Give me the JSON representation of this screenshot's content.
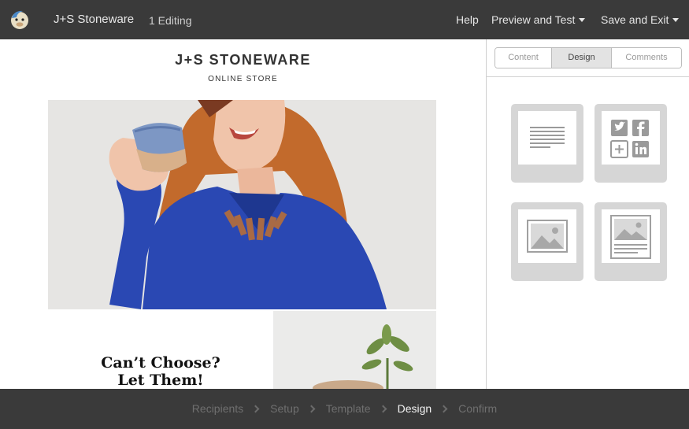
{
  "topbar": {
    "logo_icon": "mailchimp-freddie-icon",
    "app_title": "J+S Stoneware",
    "editing_status": "1 Editing",
    "help_label": "Help",
    "preview_label": "Preview and Test",
    "save_label": "Save and Exit"
  },
  "email": {
    "brand_name": "J+S STONEWARE",
    "brand_subtitle": "ONLINE STORE",
    "headline_line1": "Can’t Choose?",
    "headline_line2": "Let Them!"
  },
  "panel": {
    "tabs": [
      {
        "label": "Content",
        "active": false
      },
      {
        "label": "Design",
        "active": true
      },
      {
        "label": "Comments",
        "active": false
      }
    ],
    "blocks": [
      {
        "icon": "text-block-icon"
      },
      {
        "icon": "social-follow-block-icon"
      },
      {
        "icon": "image-block-icon"
      },
      {
        "icon": "image-card-block-icon"
      }
    ]
  },
  "steps": [
    {
      "label": "Recipients",
      "current": false
    },
    {
      "label": "Setup",
      "current": false
    },
    {
      "label": "Template",
      "current": false
    },
    {
      "label": "Design",
      "current": true
    },
    {
      "label": "Confirm",
      "current": false
    }
  ],
  "colors": {
    "bar_background": "#3a3a3a",
    "block_gray": "#d6d6d6",
    "shirt_blue": "#2a48b3",
    "hair_orange": "#c9702e"
  }
}
